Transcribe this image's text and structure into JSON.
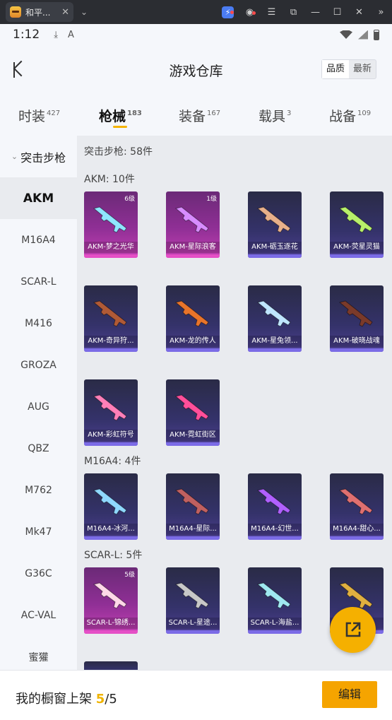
{
  "window": {
    "tab_title": "和平...",
    "tab_close": "✕",
    "tab_menu": "⌄"
  },
  "status": {
    "time": "1:12"
  },
  "header": {
    "title": "游戏仓库",
    "sort_options": [
      "品质",
      "最新"
    ]
  },
  "categories": [
    {
      "label": "时装",
      "count": "427"
    },
    {
      "label": "枪械",
      "count": "183"
    },
    {
      "label": "装备",
      "count": "167"
    },
    {
      "label": "载具",
      "count": "3"
    },
    {
      "label": "战备",
      "count": "109"
    }
  ],
  "sidebar": {
    "group": "突击步枪",
    "items": [
      "AKM",
      "M16A4",
      "SCAR-L",
      "M416",
      "GROZA",
      "AUG",
      "QBZ",
      "M762",
      "Mk47",
      "G36C",
      "AC-VAL",
      "蜜獾"
    ]
  },
  "main": {
    "summary": "突击步枪: 58件",
    "sections": [
      {
        "header": "AKM: 10件",
        "items": [
          {
            "name": "AKM-梦之光华",
            "badge": "6级",
            "rarity": "pink",
            "color": "#8fe6ff"
          },
          {
            "name": "AKM-星际浪客",
            "badge": "1级",
            "rarity": "pink",
            "color": "#d88cff"
          },
          {
            "name": "AKM-砺玉逐花",
            "badge": "",
            "rarity": "purple",
            "color": "#e8b08a"
          },
          {
            "name": "AKM-荧星灵猫",
            "badge": "",
            "rarity": "purple",
            "color": "#b8f06a"
          },
          {
            "name": "AKM-奇异狩...",
            "badge": "",
            "rarity": "purple",
            "color": "#b05a36"
          },
          {
            "name": "AKM-龙的传人",
            "badge": "",
            "rarity": "purple",
            "color": "#e8742a"
          },
          {
            "name": "AKM-星兔领...",
            "badge": "",
            "rarity": "purple",
            "color": "#bfe6ff"
          },
          {
            "name": "AKM-破晓战魂",
            "badge": "",
            "rarity": "purple",
            "color": "#7a3a2a"
          },
          {
            "name": "AKM-彩虹符号",
            "badge": "",
            "rarity": "purple",
            "color": "#ff7fb8"
          },
          {
            "name": "AKM-霓虹街区",
            "badge": "",
            "rarity": "purple",
            "color": "#ff4f9a"
          }
        ]
      },
      {
        "header": "M16A4: 4件",
        "items": [
          {
            "name": "M16A4-冰河...",
            "badge": "",
            "rarity": "purple",
            "color": "#8fd8ff"
          },
          {
            "name": "M16A4-星际...",
            "badge": "",
            "rarity": "purple",
            "color": "#c06060"
          },
          {
            "name": "M16A4-幻世...",
            "badge": "",
            "rarity": "purple",
            "color": "#b060ff"
          },
          {
            "name": "M16A4-甜心...",
            "badge": "",
            "rarity": "purple",
            "color": "#e07070"
          }
        ]
      },
      {
        "header": "SCAR-L: 5件",
        "items": [
          {
            "name": "SCAR-L-锦绣...",
            "badge": "5级",
            "rarity": "pink",
            "color": "#ffd8e8"
          },
          {
            "name": "SCAR-L-星途...",
            "badge": "",
            "rarity": "purple",
            "color": "#c8c8c8"
          },
          {
            "name": "SCAR-L-海盐...",
            "badge": "",
            "rarity": "purple",
            "color": "#9fe8f0"
          },
          {
            "name": "",
            "badge": "",
            "rarity": "purple",
            "color": "#e0b040"
          }
        ]
      }
    ]
  },
  "bottom": {
    "label": "我的橱窗上架",
    "current": "5",
    "separator": "/",
    "total": "5",
    "edit": "编辑"
  },
  "colors": {
    "accent": "#f5a400",
    "card_pink": "#c23fb2",
    "card_purple": "#4c3f90"
  }
}
